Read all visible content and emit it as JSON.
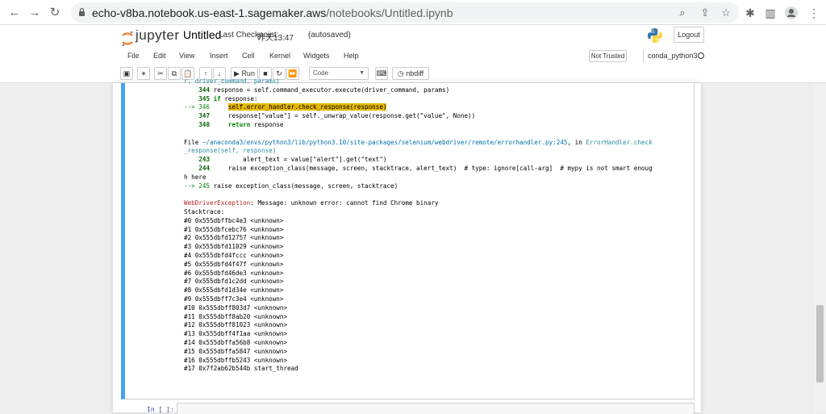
{
  "browser": {
    "url_host": "echo-v8ba.notebook.us-east-1.sagemaker.aws",
    "url_path": "/notebooks/Untitled.ipynb"
  },
  "jupyter": {
    "brand": "jupyter",
    "notebook_title": "Untitled",
    "checkpoint_label": "Last Checkpoint:",
    "checkpoint_time": "昨天13:47",
    "autosave_status": "(autosaved)",
    "logout_label": "Logout",
    "menu": [
      "File",
      "Edit",
      "View",
      "Insert",
      "Cell",
      "Kernel",
      "Widgets",
      "Help"
    ],
    "trust_label": "Not Trusted",
    "kernel_name": "conda_python3",
    "toolbar": {
      "run_label": "Run",
      "cell_type": "Code",
      "nbdiff_label": "nbdiff"
    }
  },
  "output": {
    "lines": {
      "l0": "r, driver_command, params)",
      "l1_num": "344",
      "l1_text": " response = self.command_executor.execute(driver_command, params)",
      "l2_num": "345",
      "l2_kw": "if",
      "l2_text": " response:",
      "l3_arrow": "--> 346",
      "l3_hl": "self.error_handler.check_response(response)",
      "l4_num": "347",
      "l4_text": "response[\"value\"] = self._unwrap_value(response.get(\"value\", None))",
      "l5_num": "348",
      "l5_kw": "return",
      "l5_text": " response"
    },
    "file_prefix": "File ",
    "file_path": "~/anaconda3/envs/python3/lib/python3.10/site-packages/selenium/webdriver/remote/errorhandler.py:245",
    "file_in": ", in ",
    "file_func1": "ErrorHandler.check",
    "file_func2": "_response(self, response)",
    "tb": {
      "a_num": "243",
      "a_text": "alert_text = value[\"alert\"].get(\"text\")",
      "b_num": "244",
      "b_text": "raise exception_class(message, screen, stacktrace, alert_text)  # type: ignore[call-arg]  # mypy is not smart enoug",
      "b_cont": "h here",
      "c_arrow": "--> 245",
      "c_text": "raise exception_class(message, screen, stacktrace)"
    },
    "exception_name": "WebDriverException",
    "exception_msg": ": Message: unknown error: cannot find Chrome binary",
    "stacktrace_label": "Stacktrace:",
    "frames": [
      "#0 0x555dbffbc4e3 <unknown>",
      "#1 0x555dbfcebc76 <unknown>",
      "#2 0x555dbfd12757 <unknown>",
      "#3 0x555dbfd11029 <unknown>",
      "#4 0x555dbfd4fccc <unknown>",
      "#5 0x555dbfd4f47f <unknown>",
      "#6 0x555dbfd46de3 <unknown>",
      "#7 0x555dbfd1c2dd <unknown>",
      "#8 0x555dbfd1d34e <unknown>",
      "#9 0x555dbff7c3e4 <unknown>",
      "#10 0x555dbff803d7 <unknown>",
      "#11 0x555dbff8ab20 <unknown>",
      "#12 0x555dbff81023 <unknown>",
      "#13 0x555dbff4f1aa <unknown>",
      "#14 0x555dbffa56b8 <unknown>",
      "#15 0x555dbffa5847 <unknown>",
      "#16 0x555dbffb5243 <unknown>",
      "#17 0x7f2ab62b544b start_thread"
    ]
  },
  "next_cell_prompt": "In [ ]:",
  "colors": {
    "selected_cell_bar": "#42a5f5",
    "highlight": "#e5b800"
  }
}
